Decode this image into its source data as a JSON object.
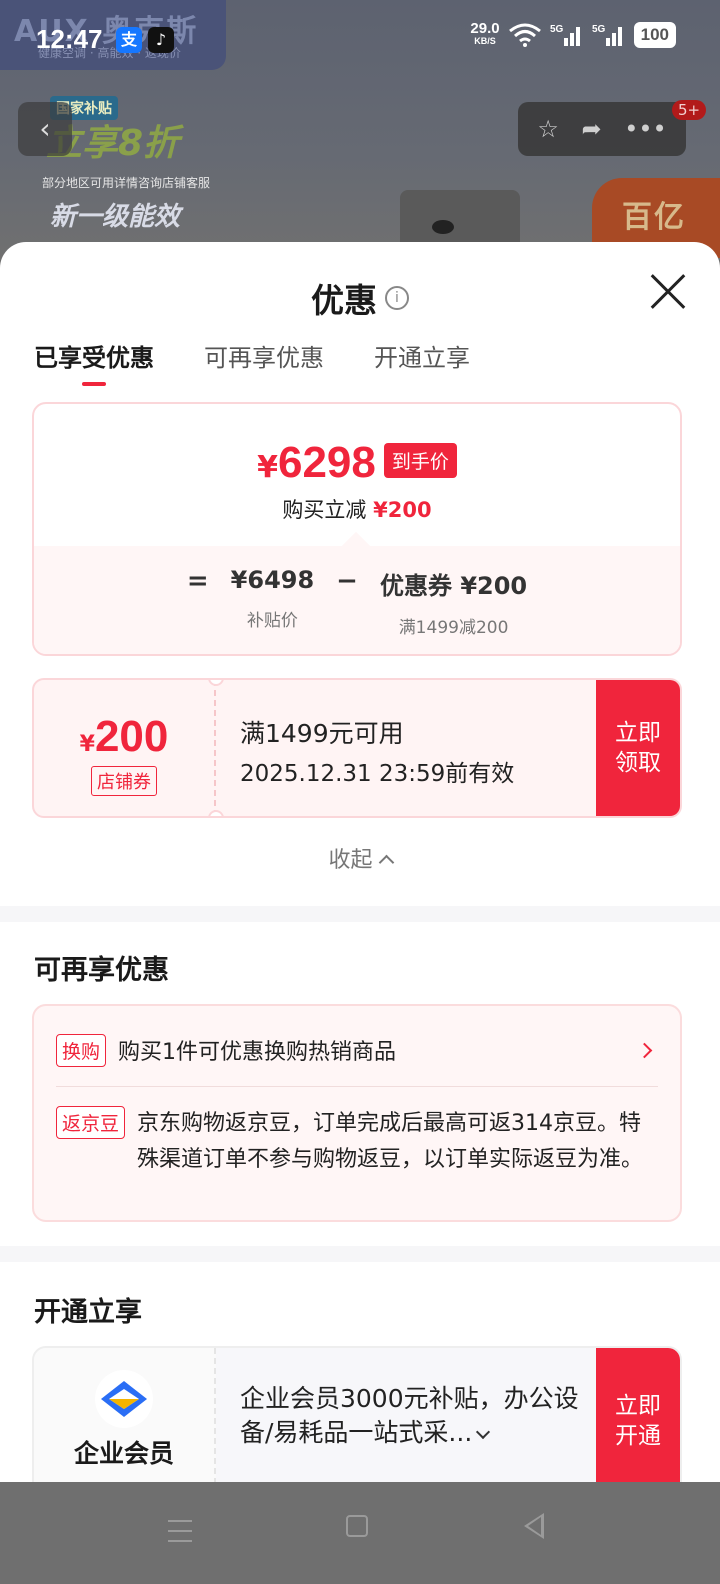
{
  "status_bar": {
    "time": "12:47",
    "net_speed": "29.0",
    "net_unit": "KB/S",
    "battery": "100",
    "icons": [
      "alipay-icon",
      "tiktok-icon",
      "wifi-icon",
      "signal-5g-icon",
      "signal-5g-icon",
      "battery-icon"
    ]
  },
  "background": {
    "brand": "AUX 奥克斯",
    "brand_sub": "健康空调 · 高能效 · 返现价",
    "banner_l1": "国家补贴",
    "banner_l2": "立享8折",
    "banner_l3": "部分地区可用详情咨询店铺客服",
    "banner_l4": "新一级能效",
    "badge": "百亿",
    "cart_badge": "5+"
  },
  "sheet": {
    "title": "优惠",
    "tabs": [
      "已享受优惠",
      "可再享优惠",
      "开通立享"
    ]
  },
  "price_card": {
    "final_yen": "¥",
    "final_price": "6298",
    "final_tag": "到手价",
    "reduce_label": "购买立减",
    "reduce_amount": "¥200",
    "eq": "=",
    "base_price": "¥6498",
    "base_label": "补贴价",
    "minus": "−",
    "coupon_value": "优惠券 ¥200",
    "coupon_label": "满1499减200"
  },
  "coupon": {
    "yen": "¥",
    "amount": "200",
    "type": "店铺券",
    "condition": "满1499元可用",
    "expiry": "2025.12.31 23:59前有效",
    "button": "立即领取"
  },
  "collapse_label": "收起",
  "more_section": {
    "title": "可再享优惠",
    "item1_tag": "换购",
    "item1_text": "购买1件可优惠换购热销商品",
    "item2_tag": "返京豆",
    "item2_text": "京东购物返京豆，订单完成后最高可返314京豆。特殊渠道订单不参与购物返豆，以订单实际返豆为准。"
  },
  "open_section": {
    "title": "开通立享",
    "vip_name": "企业会员",
    "vip_desc": "企业会员3000元补贴，办公设备/易耗品一站式采...",
    "button": "立即开通"
  },
  "colors": {
    "accent": "#f0253c",
    "pink_border": "#fbd6d9",
    "pink_bg": "#fff6f6"
  }
}
